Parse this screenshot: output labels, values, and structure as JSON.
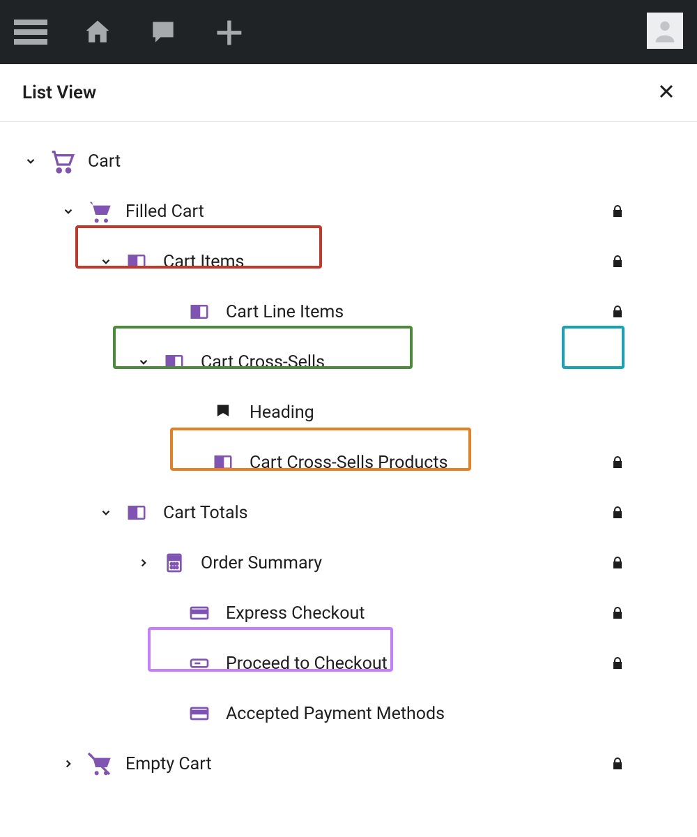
{
  "panel": {
    "title": "List View"
  },
  "tree": {
    "cart": "Cart",
    "filled_cart": "Filled Cart",
    "cart_items": "Cart Items",
    "cart_line_items": "Cart Line Items",
    "cart_cross_sells": "Cart Cross-Sells",
    "heading": "Heading",
    "cart_cross_sells_products": "Cart Cross-Sells Products",
    "cart_totals": "Cart Totals",
    "order_summary": "Order Summary",
    "express_checkout": "Express Checkout",
    "proceed_to_checkout": "Proceed to Checkout",
    "accepted_payment_methods": "Accepted Payment Methods",
    "empty_cart": "Empty Cart"
  }
}
